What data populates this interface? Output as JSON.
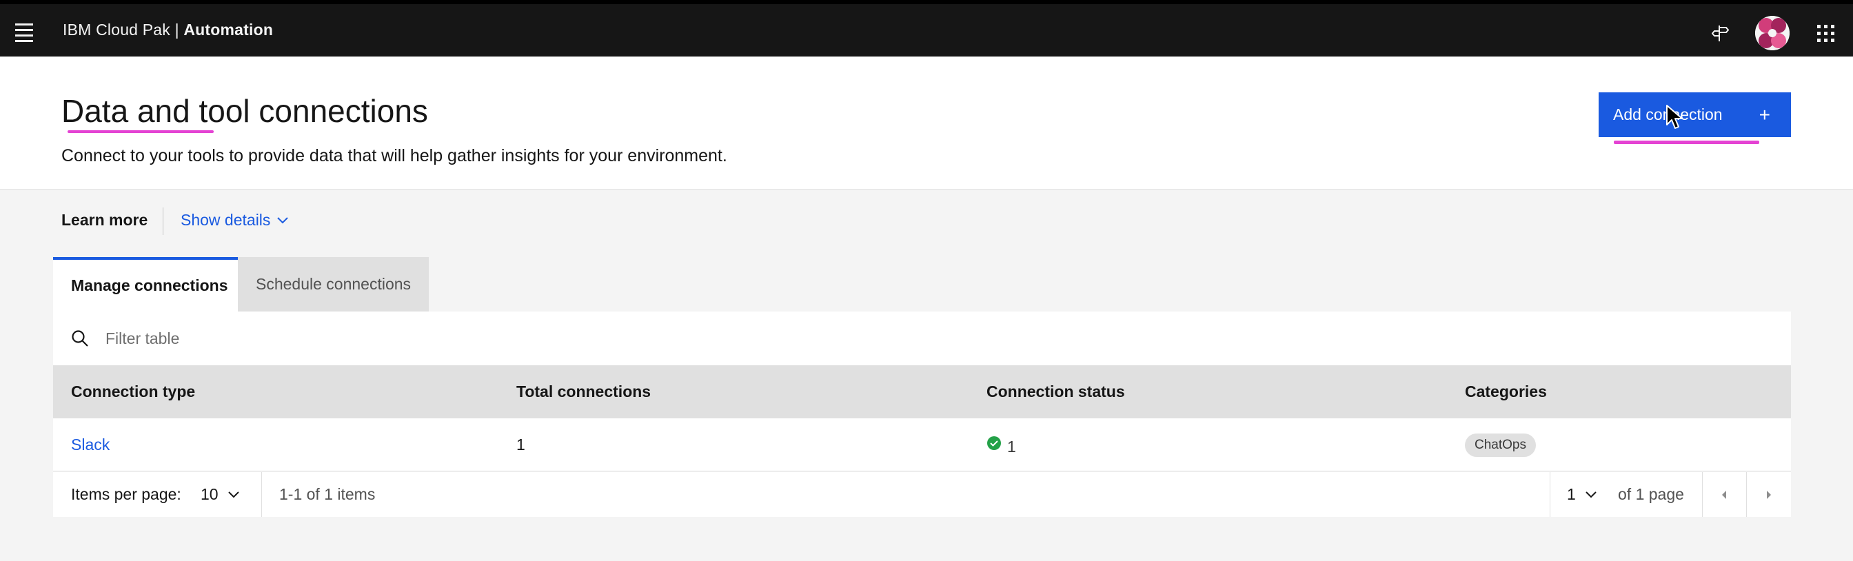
{
  "header": {
    "brand_prefix": "IBM Cloud Pak | ",
    "brand_product": "Automation",
    "icons": [
      "hamburger-menu-icon",
      "signpost-icon",
      "avatar",
      "app-switcher-icon"
    ]
  },
  "page": {
    "title": "Data and tool connections",
    "subtitle": "Connect to your tools to provide data that will help gather insights for your environment.",
    "add_button_label": "Add connection"
  },
  "learn_more": {
    "label": "Learn more",
    "show_details": "Show details"
  },
  "tabs": [
    {
      "label": "Manage connections",
      "selected": true
    },
    {
      "label": "Schedule connections",
      "selected": false
    }
  ],
  "search": {
    "placeholder": "Filter table",
    "value": ""
  },
  "table": {
    "columns": [
      "Connection type",
      "Total connections",
      "Connection status",
      "Categories"
    ],
    "rows": [
      {
        "type": "Slack",
        "total": "1",
        "status_count": "1",
        "status": "success",
        "category": "ChatOps"
      }
    ]
  },
  "pagination": {
    "items_per_page_label": "Items per page:",
    "items_per_page": "10",
    "range": "1-1 of 1 items",
    "page": "1",
    "of_pages": "of 1 page"
  },
  "colors": {
    "accent": "#1a5ae0",
    "header_bg": "#161616",
    "highlight": "#e443d3",
    "success": "#24a148"
  }
}
